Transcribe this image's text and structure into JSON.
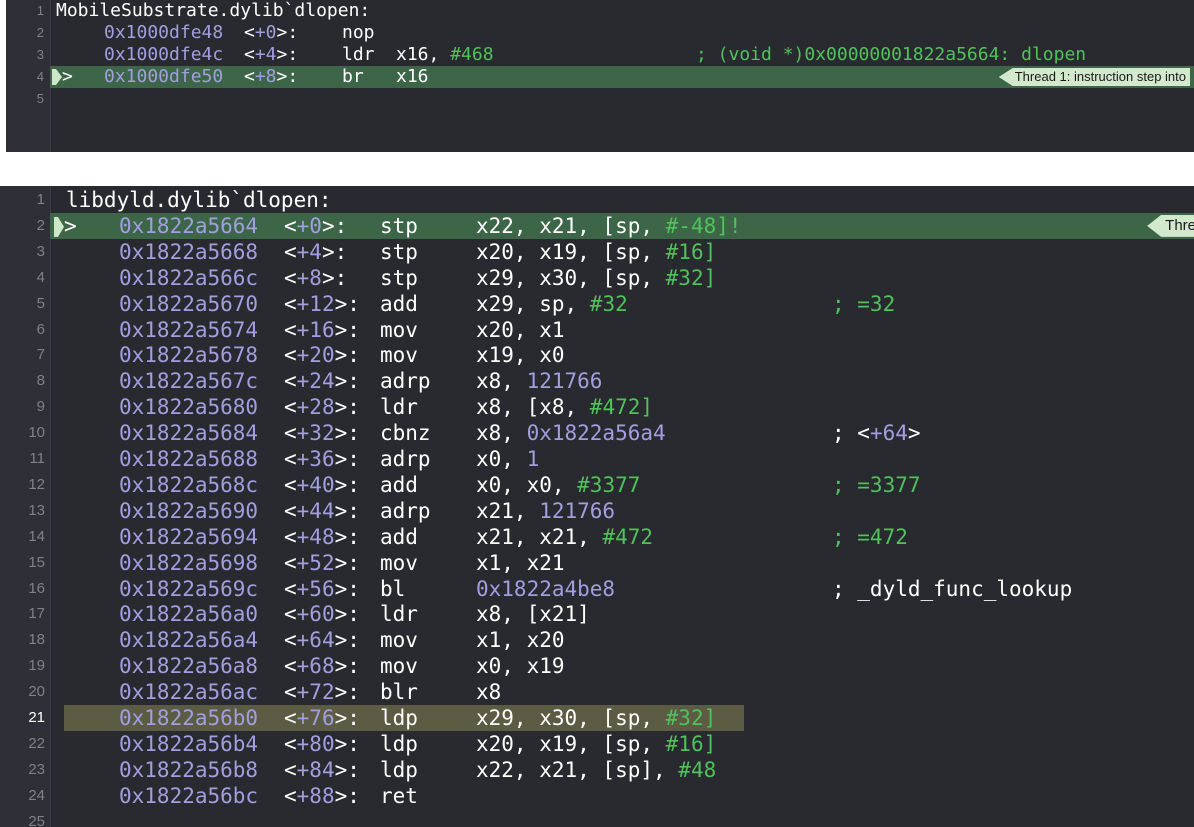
{
  "pane1": {
    "lines": [
      {
        "n": "1",
        "addr": "",
        "off": "",
        "mnem": "",
        "ops": "",
        "comment": "",
        "label": "MobileSubstrate.dylib`dlopen:"
      },
      {
        "n": "2",
        "addr": "0x1000dfe48",
        "off": "<+0>:",
        "mnem": "nop",
        "ops": "",
        "comment": ""
      },
      {
        "n": "3",
        "addr": "0x1000dfe4c",
        "off": "<+4>:",
        "mnem": "ldr",
        "ops": "x16, #468",
        "comment": "; (void *)0x00000001822a5664: dlopen"
      },
      {
        "n": "4",
        "addr": "0x1000dfe50",
        "off": "<+8>:",
        "mnem": "br",
        "ops": "x16",
        "comment": ""
      },
      {
        "n": "5",
        "addr": "",
        "off": "",
        "mnem": "",
        "ops": "",
        "comment": ""
      }
    ],
    "badge": "Thread 1: instruction step into"
  },
  "pane2": {
    "badge": "Thre",
    "lines": [
      {
        "n": "1",
        "label": "libdyld.dylib`dlopen:"
      },
      {
        "n": "2",
        "addr": "0x1822a5664",
        "off": "<+0>:",
        "mnem": "stp",
        "ops": "x22, x21, [sp, #-48]!",
        "comment": ""
      },
      {
        "n": "3",
        "addr": "0x1822a5668",
        "off": "<+4>:",
        "mnem": "stp",
        "ops": "x20, x19, [sp, #16]",
        "comment": ""
      },
      {
        "n": "4",
        "addr": "0x1822a566c",
        "off": "<+8>:",
        "mnem": "stp",
        "ops": "x29, x30, [sp, #32]",
        "comment": ""
      },
      {
        "n": "5",
        "addr": "0x1822a5670",
        "off": "<+12>:",
        "mnem": "add",
        "ops": "x29, sp, #32",
        "comment": "; =32"
      },
      {
        "n": "6",
        "addr": "0x1822a5674",
        "off": "<+16>:",
        "mnem": "mov",
        "ops": "x20, x1",
        "comment": ""
      },
      {
        "n": "7",
        "addr": "0x1822a5678",
        "off": "<+20>:",
        "mnem": "mov",
        "ops": "x19, x0",
        "comment": ""
      },
      {
        "n": "8",
        "addr": "0x1822a567c",
        "off": "<+24>:",
        "mnem": "adrp",
        "ops": "x8, 121766",
        "comment": ""
      },
      {
        "n": "9",
        "addr": "0x1822a5680",
        "off": "<+28>:",
        "mnem": "ldr",
        "ops": "x8, [x8, #472]",
        "comment": ""
      },
      {
        "n": "10",
        "addr": "0x1822a5684",
        "off": "<+32>:",
        "mnem": "cbnz",
        "ops": "x8, 0x1822a56a4",
        "comment": "; <+64>"
      },
      {
        "n": "11",
        "addr": "0x1822a5688",
        "off": "<+36>:",
        "mnem": "adrp",
        "ops": "x0, 1",
        "comment": ""
      },
      {
        "n": "12",
        "addr": "0x1822a568c",
        "off": "<+40>:",
        "mnem": "add",
        "ops": "x0, x0, #3377",
        "comment": "; =3377"
      },
      {
        "n": "13",
        "addr": "0x1822a5690",
        "off": "<+44>:",
        "mnem": "adrp",
        "ops": "x21, 121766",
        "comment": ""
      },
      {
        "n": "14",
        "addr": "0x1822a5694",
        "off": "<+48>:",
        "mnem": "add",
        "ops": "x21, x21, #472",
        "comment": "; =472"
      },
      {
        "n": "15",
        "addr": "0x1822a5698",
        "off": "<+52>:",
        "mnem": "mov",
        "ops": "x1, x21",
        "comment": ""
      },
      {
        "n": "16",
        "addr": "0x1822a569c",
        "off": "<+56>:",
        "mnem": "bl",
        "ops": "0x1822a4be8",
        "comment": "; _dyld_func_lookup"
      },
      {
        "n": "17",
        "addr": "0x1822a56a0",
        "off": "<+60>:",
        "mnem": "ldr",
        "ops": "x8, [x21]",
        "comment": ""
      },
      {
        "n": "18",
        "addr": "0x1822a56a4",
        "off": "<+64>:",
        "mnem": "mov",
        "ops": "x1, x20",
        "comment": ""
      },
      {
        "n": "19",
        "addr": "0x1822a56a8",
        "off": "<+68>:",
        "mnem": "mov",
        "ops": "x0, x19",
        "comment": ""
      },
      {
        "n": "20",
        "addr": "0x1822a56ac",
        "off": "<+72>:",
        "mnem": "blr",
        "ops": "x8",
        "comment": ""
      },
      {
        "n": "21",
        "addr": "0x1822a56b0",
        "off": "<+76>:",
        "mnem": "ldp",
        "ops": "x29, x30, [sp, #32]",
        "comment": ""
      },
      {
        "n": "22",
        "addr": "0x1822a56b4",
        "off": "<+80>:",
        "mnem": "ldp",
        "ops": "x20, x19, [sp, #16]",
        "comment": ""
      },
      {
        "n": "23",
        "addr": "0x1822a56b8",
        "off": "<+84>:",
        "mnem": "ldp",
        "ops": "x22, x21, [sp], #48",
        "comment": ""
      },
      {
        "n": "24",
        "addr": "0x1822a56bc",
        "off": "<+88>:",
        "mnem": "ret",
        "ops": "",
        "comment": ""
      },
      {
        "n": "25",
        "label": ""
      }
    ]
  },
  "colors": {
    "background": "#292a30",
    "address": "#a29ee0",
    "number": "#4fc25a",
    "current_line": "#3d6648",
    "cursor_line": "#5c5c44"
  }
}
